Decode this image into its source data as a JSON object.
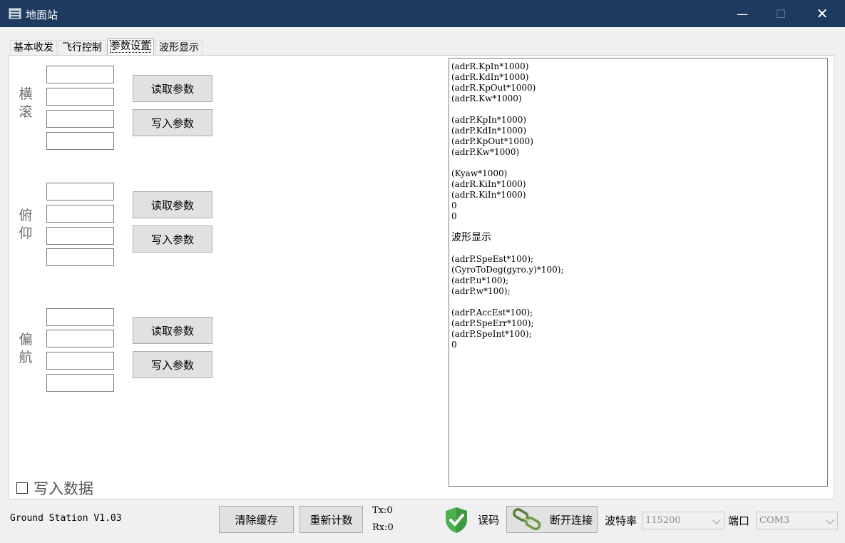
{
  "window": {
    "title": "地面站",
    "minimize_glyph": "—",
    "maximize_glyph": "☐",
    "close_glyph": "✕"
  },
  "tabs": [
    {
      "label": "基本收发"
    },
    {
      "label": "飞行控制"
    },
    {
      "label": "参数设置",
      "active": true
    },
    {
      "label": "波形显示"
    }
  ],
  "groups": {
    "roll": {
      "label_top": "横",
      "label_bottom": "滚"
    },
    "pitch": {
      "label_top": "俯",
      "label_bottom": "仰"
    },
    "yaw": {
      "label_top": "偏",
      "label_bottom": "航"
    }
  },
  "buttons": {
    "read": "读取参数",
    "write": "写入参数"
  },
  "write_data": {
    "label": "写入数据",
    "checked": false
  },
  "log_lines": [
    "(adrR.KpIn*1000)",
    "(adrR.KdIn*1000)",
    "(adrR.KpOut*1000)",
    "(adrR.Kw*1000)",
    "",
    "(adrP.KpIn*1000)",
    "(adrP.KdIn*1000)",
    "(adrP.KpOut*1000)",
    "(adrP.Kw*1000)",
    "",
    "(Kyaw*1000)",
    "(adrR.KiIn*1000)",
    "(adrR.KiIn*1000)",
    "0",
    "0",
    "",
    "波形显示",
    "",
    "(adrP.SpeEst*100);",
    "(GyroToDeg(gyro.y)*100);",
    "(adrP.u*100);",
    "(adrP.w*100);",
    "",
    "(adrP.AccEst*100);",
    "(adrP.SpeErr*100);",
    "(adrP.SpeInt*100);",
    "0"
  ],
  "status": {
    "version": "Ground Station V1.03",
    "clear_cache": "清除缓存",
    "reset_count": "重新计数",
    "tx": "Tx:0",
    "rx": "Rx:0",
    "error_code": "误码",
    "disconnect": "断开连接",
    "baud_label": "波特率",
    "baud_value": "115200",
    "port_label": "端口",
    "port_value": "COM3"
  },
  "colors": {
    "titlebar": "#1e3a5f",
    "shield": "#4caf50"
  },
  "icons": [
    "app-icon",
    "shield-check-icon",
    "chain-link-icon",
    "chevron-down-icon"
  ]
}
